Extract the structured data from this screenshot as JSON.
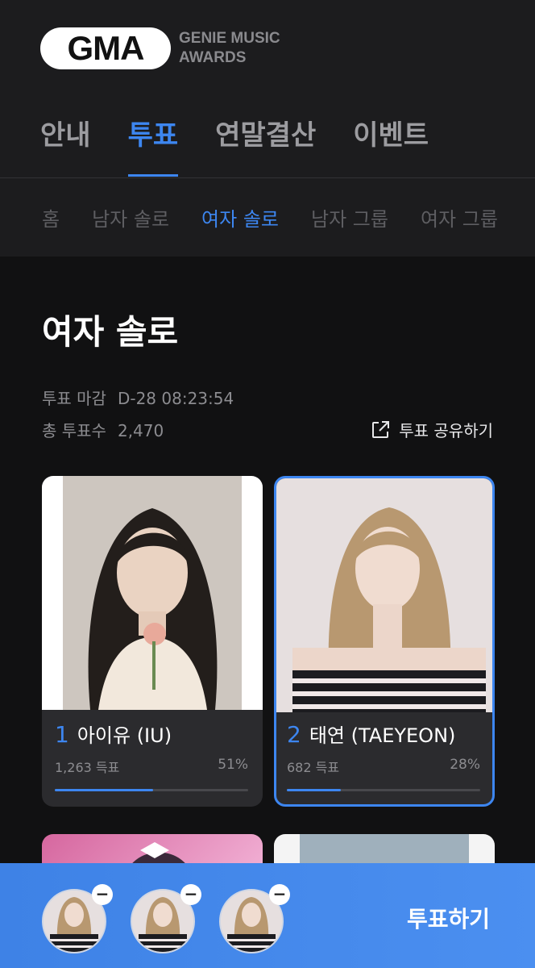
{
  "logo": {
    "mark": "GMA",
    "line1": "GENIE MUSIC",
    "line2": "AWARDS"
  },
  "main_tabs": [
    {
      "label": "안내",
      "active": false
    },
    {
      "label": "투표",
      "active": true
    },
    {
      "label": "연말결산",
      "active": false
    },
    {
      "label": "이벤트",
      "active": false
    }
  ],
  "sub_tabs": [
    {
      "label": "홈",
      "active": false
    },
    {
      "label": "남자 솔로",
      "active": false
    },
    {
      "label": "여자 솔로",
      "active": true
    },
    {
      "label": "남자 그룹",
      "active": false
    },
    {
      "label": "여자 그룹",
      "active": false
    }
  ],
  "page": {
    "title": "여자 솔로",
    "deadline_label": "투표 마감",
    "deadline_value": "D-28 08:23:54",
    "total_label": "총 투표수",
    "total_value": "2,470",
    "share_label": "투표 공유하기"
  },
  "candidates": [
    {
      "rank": "1",
      "name": "아이유 (IU)",
      "votes": "1,263",
      "votes_unit": "득표",
      "percent": "51%",
      "fraction": 0.51,
      "selected": false
    },
    {
      "rank": "2",
      "name": "태연 (TAEYEON)",
      "votes": "682",
      "votes_unit": "득표",
      "percent": "28%",
      "fraction": 0.28,
      "selected": true
    }
  ],
  "vote_bar": {
    "button_label": "투표하기",
    "remove_icon": "minus-icon",
    "slot_count": 3
  },
  "colors": {
    "accent": "#3d86f0",
    "background": "#111112",
    "header": "#1c1c1e",
    "card": "#2b2b2e"
  }
}
